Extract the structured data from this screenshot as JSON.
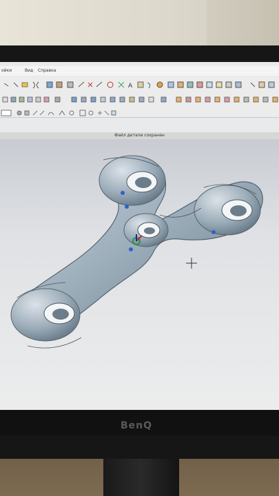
{
  "menu": {
    "item1": "ойки",
    "item2": "Вид",
    "item3": "Справка"
  },
  "status_message": "Файл детали сохранен",
  "monitor_logo": "BenQ",
  "colors": {
    "viewport_bg": "#dfe1e4",
    "model_fill": "#8fa0ae",
    "model_highlight": "#d4dbe2",
    "toolbar_bg": "#ececec"
  }
}
